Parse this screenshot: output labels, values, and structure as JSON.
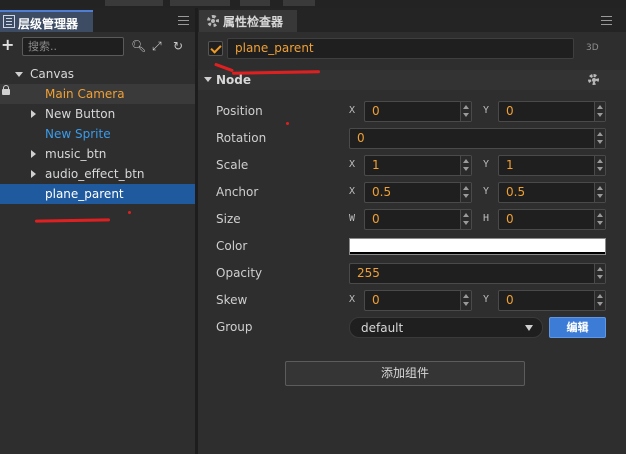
{
  "hierarchy": {
    "tab_label": "层级管理器",
    "search_placeholder": "搜索..",
    "nodes": [
      {
        "label": "Canvas",
        "color": "#d8d8d8"
      },
      {
        "label": "Main Camera",
        "color": "#f0a035"
      },
      {
        "label": "New Button",
        "color": "#d8d8d8"
      },
      {
        "label": "New Sprite",
        "color": "#3a9bea"
      },
      {
        "label": "music_btn",
        "color": "#d8d8d8"
      },
      {
        "label": "audio_effect_btn",
        "color": "#d8d8d8"
      },
      {
        "label": "plane_parent",
        "color": "#ffffff"
      }
    ]
  },
  "inspector": {
    "tab_label": "属性检查器",
    "node_name": "plane_parent",
    "mode_tag": "3D",
    "section_title": "Node",
    "props": {
      "position": {
        "label": "Position",
        "x_axis": "X",
        "x": "0",
        "y_axis": "Y",
        "y": "0"
      },
      "rotation": {
        "label": "Rotation",
        "value": "0"
      },
      "scale": {
        "label": "Scale",
        "x_axis": "X",
        "x": "1",
        "y_axis": "Y",
        "y": "1"
      },
      "anchor": {
        "label": "Anchor",
        "x_axis": "X",
        "x": "0.5",
        "y_axis": "Y",
        "y": "0.5"
      },
      "size": {
        "label": "Size",
        "w_axis": "W",
        "w": "0",
        "h_axis": "H",
        "h": "0"
      },
      "color": {
        "label": "Color",
        "value": "#ffffff"
      },
      "opacity": {
        "label": "Opacity",
        "value": "255"
      },
      "skew": {
        "label": "Skew",
        "x_axis": "X",
        "x": "0",
        "y_axis": "Y",
        "y": "0"
      },
      "group": {
        "label": "Group",
        "value": "default",
        "edit_label": "编辑"
      }
    },
    "add_component_label": "添加组件"
  },
  "colors": {
    "accent_orange": "#f0a035",
    "selection_blue": "#1f5a9e",
    "edit_button_blue": "#3c7bd6"
  }
}
